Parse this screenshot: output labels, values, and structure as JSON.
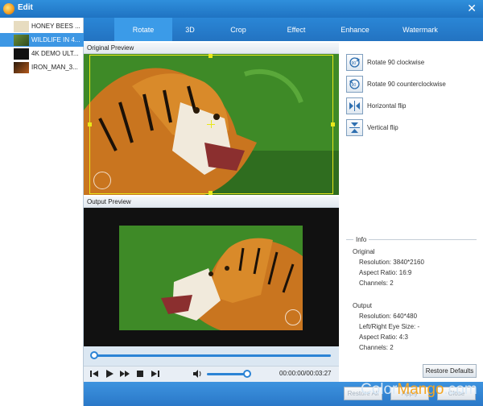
{
  "window": {
    "title": "Edit"
  },
  "files": [
    {
      "label": "HONEY BEES ...",
      "thumb": "#e7dcc0"
    },
    {
      "label": "WILDLIFE IN 4...",
      "thumb": "#4a6b33"
    },
    {
      "label": "4K DEMO ULT...",
      "thumb": "#111111"
    },
    {
      "label": "IRON_MAN_3...",
      "thumb": "#7a3d14"
    }
  ],
  "tabs": [
    "Rotate",
    "3D",
    "Crop",
    "Effect",
    "Enhance",
    "Watermark"
  ],
  "active_tab": "Rotate",
  "sections": {
    "original": "Original Preview",
    "output": "Output Preview"
  },
  "tools": [
    {
      "label": "Rotate 90 clockwise",
      "icon": "rotate-cw-icon"
    },
    {
      "label": "Rotate 90 counterclockwise",
      "icon": "rotate-ccw-icon"
    },
    {
      "label": "Horizontal flip",
      "icon": "flip-horizontal-icon"
    },
    {
      "label": "Vertical flip",
      "icon": "flip-vertical-icon"
    }
  ],
  "info": {
    "legend": "Info",
    "original_header": "Original",
    "original": {
      "resolution": "Resolution: 3840*2160",
      "aspect": "Aspect Ratio: 16:9",
      "channels": "Channels: 2"
    },
    "output_header": "Output",
    "output": {
      "resolution": "Resolution: 640*480",
      "eye_size": "Left/Right Eye Size: -",
      "aspect": "Aspect Ratio: 4:3",
      "channels": "Channels: 2"
    }
  },
  "player": {
    "time": "00:00:00/00:03:27",
    "progress": 0.0,
    "volume": 0.9
  },
  "buttons": {
    "restore_defaults": "Restore Defaults",
    "restore_all": "Restore All",
    "apply": "Apply",
    "close": "Close"
  },
  "brand": {
    "part1": "Color",
    "part2": "Mango",
    "part3": ".com"
  },
  "colors": {
    "accent": "#2a86d6",
    "active_tab": "#3b9be8",
    "crop_frame": "#e8e81a"
  }
}
